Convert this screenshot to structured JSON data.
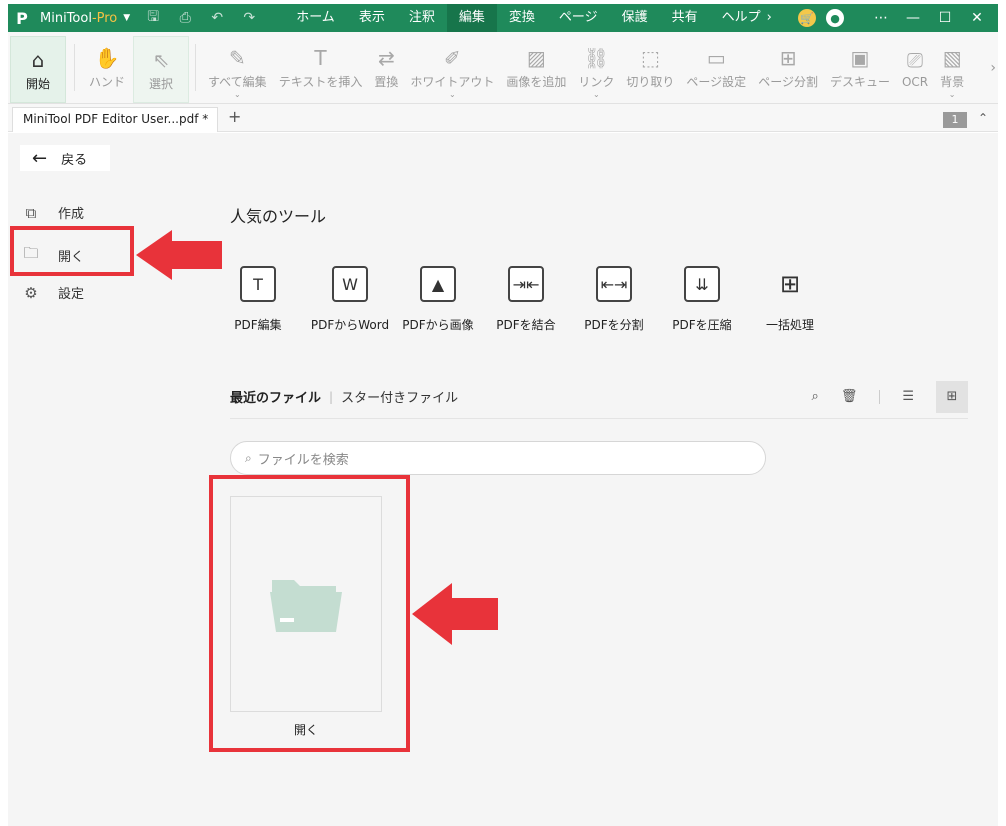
{
  "app": {
    "logo_letter": "P",
    "name": "MiniTool",
    "edition": "-Pro",
    "menus": [
      "ホーム",
      "表示",
      "注釈",
      "編集",
      "変換",
      "ページ",
      "保護",
      "共有",
      "ヘルプ"
    ],
    "active_menu": "編集"
  },
  "toolbar": {
    "items": [
      {
        "label": "開始",
        "icon": "home-icon"
      },
      {
        "label": "ハンド",
        "icon": "hand-icon"
      },
      {
        "label": "選択",
        "icon": "cursor-icon"
      },
      {
        "label": "すべて編集",
        "icon": "edit-icon"
      },
      {
        "label": "テキストを挿入",
        "icon": "text-icon"
      },
      {
        "label": "置換",
        "icon": "replace-icon"
      },
      {
        "label": "ホワイトアウト",
        "icon": "eraser-icon"
      },
      {
        "label": "画像を追加",
        "icon": "image-icon"
      },
      {
        "label": "リンク",
        "icon": "link-icon"
      },
      {
        "label": "切り取り",
        "icon": "crop-icon"
      },
      {
        "label": "ページ設定",
        "icon": "page-setup-icon"
      },
      {
        "label": "ページ分割",
        "icon": "split-page-icon"
      },
      {
        "label": "デスキュー",
        "icon": "deskew-icon"
      },
      {
        "label": "OCR",
        "icon": "ocr-icon"
      },
      {
        "label": "背景",
        "icon": "background-icon"
      }
    ]
  },
  "tabs": {
    "doc_title": "MiniTool PDF Editor User...pdf *",
    "page_count": "1"
  },
  "sidebar": {
    "back_label": "戻る",
    "items": [
      {
        "label": "作成",
        "icon": "create-icon"
      },
      {
        "label": "開く",
        "icon": "open-folder-icon"
      },
      {
        "label": "設定",
        "icon": "gear-icon"
      }
    ]
  },
  "main": {
    "popular_title": "人気のツール",
    "tools": [
      {
        "label": "PDF編集",
        "icon": "text-edit-icon"
      },
      {
        "label": "PDFからWord",
        "icon": "pdf-to-word-icon"
      },
      {
        "label": "PDFから画像",
        "icon": "pdf-to-image-icon"
      },
      {
        "label": "PDFを結合",
        "icon": "merge-icon"
      },
      {
        "label": "PDFを分割",
        "icon": "split-icon"
      },
      {
        "label": "PDFを圧縮",
        "icon": "compress-icon"
      },
      {
        "label": "一括処理",
        "icon": "batch-icon"
      }
    ],
    "recent_label": "最近のファイル",
    "starred_label": "スター付きファイル",
    "search_placeholder": "ファイルを検索",
    "open_card_label": "開く"
  },
  "colors": {
    "brand_green": "#1f8a5b",
    "annotation_red": "#e8333a",
    "folder_tint": "#c4ddd1"
  }
}
